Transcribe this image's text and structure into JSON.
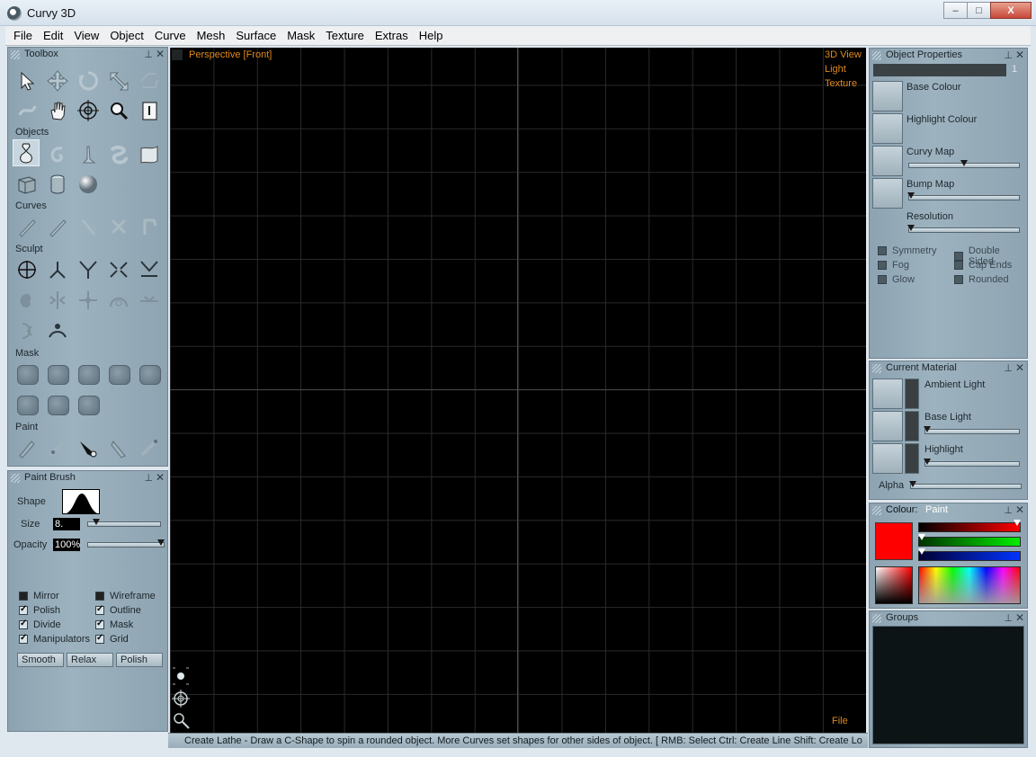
{
  "window": {
    "title": "Curvy 3D",
    "min_icon": "minimize-icon",
    "max_icon": "maximize-icon",
    "close_icon": "close-icon",
    "min_glyph": "–",
    "max_glyph": "□",
    "close_glyph": "X"
  },
  "menu": [
    "File",
    "Edit",
    "View",
    "Object",
    "Curve",
    "Mesh",
    "Surface",
    "Mask",
    "Texture",
    "Extras",
    "Help"
  ],
  "toolbox": {
    "title": "Toolbox",
    "sections": {
      "objects": "Objects",
      "curves": "Curves",
      "sculpt": "Sculpt",
      "mask": "Mask",
      "paint": "Paint"
    }
  },
  "paint_brush": {
    "title": "Paint Brush",
    "shape_label": "Shape",
    "size_label": "Size",
    "size_value": "8.",
    "size_level": 0.08,
    "opacity_label": "Opacity",
    "opacity_value": "100%",
    "opacity_level": 1.0,
    "options": [
      {
        "label": "Mirror",
        "checked": false
      },
      {
        "label": "Wireframe",
        "checked": false
      },
      {
        "label": "Polish",
        "checked": true
      },
      {
        "label": "Outline",
        "checked": true
      },
      {
        "label": "Divide",
        "checked": true
      },
      {
        "label": "Mask",
        "checked": true
      },
      {
        "label": "Manipulators",
        "checked": true
      },
      {
        "label": "Grid",
        "checked": true
      }
    ],
    "buttons": [
      "Smooth",
      "Relax",
      "Polish"
    ]
  },
  "viewport": {
    "view_label": "Perspective [Front]",
    "right_menu": [
      "3D View",
      "Light",
      "Texture"
    ],
    "file_label": "File",
    "label_color": "#e08a1a"
  },
  "status": "Create Lathe - Draw a C-Shape to spin a rounded object. More Curves set shapes for other sides of object. [ RMB: Select   Ctrl: Create Line   Shift: Create Lo",
  "object_properties": {
    "title": "Object Properties",
    "name_value": "1",
    "props": [
      "Base Colour",
      "Highlight Colour",
      "Curvy Map",
      "Bump Map",
      "Resolution"
    ],
    "curvy_map_level": 0.5,
    "options": [
      {
        "label": "Symmetry",
        "checked": false
      },
      {
        "label": "Double Sided",
        "checked": false
      },
      {
        "label": "Fog",
        "checked": false
      },
      {
        "label": "Cap Ends",
        "checked": false
      },
      {
        "label": "Glow",
        "checked": false
      },
      {
        "label": "Rounded",
        "checked": false
      }
    ]
  },
  "current_material": {
    "title": "Current Material",
    "props": [
      "Ambient Light",
      "Base Light",
      "Highlight"
    ],
    "alpha_label": "Alpha"
  },
  "colour": {
    "title": "Colour:",
    "mode": "Paint",
    "swatch": "#ff0000",
    "red": 1.0,
    "green": 0.0,
    "blue": 0.0
  },
  "groups": {
    "title": "Groups"
  }
}
